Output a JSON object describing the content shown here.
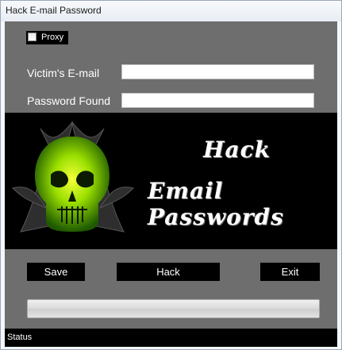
{
  "window": {
    "title": "Hack E-mail Password"
  },
  "proxy": {
    "label": "Proxy",
    "checked": false
  },
  "form": {
    "email_label": "Victim's E-mail",
    "email_value": "",
    "password_label": "Password Found",
    "password_value": ""
  },
  "banner": {
    "line1": "Hack",
    "line2": "Email Passwords",
    "skull_color": "#b6ff00"
  },
  "buttons": {
    "save": "Save",
    "hack": "Hack",
    "exit": "Exit"
  },
  "progress": {
    "value": 0
  },
  "status": {
    "text": "Status"
  },
  "colors": {
    "background": "#6e6e6e",
    "panel": "#000000",
    "text": "#ffffff"
  }
}
